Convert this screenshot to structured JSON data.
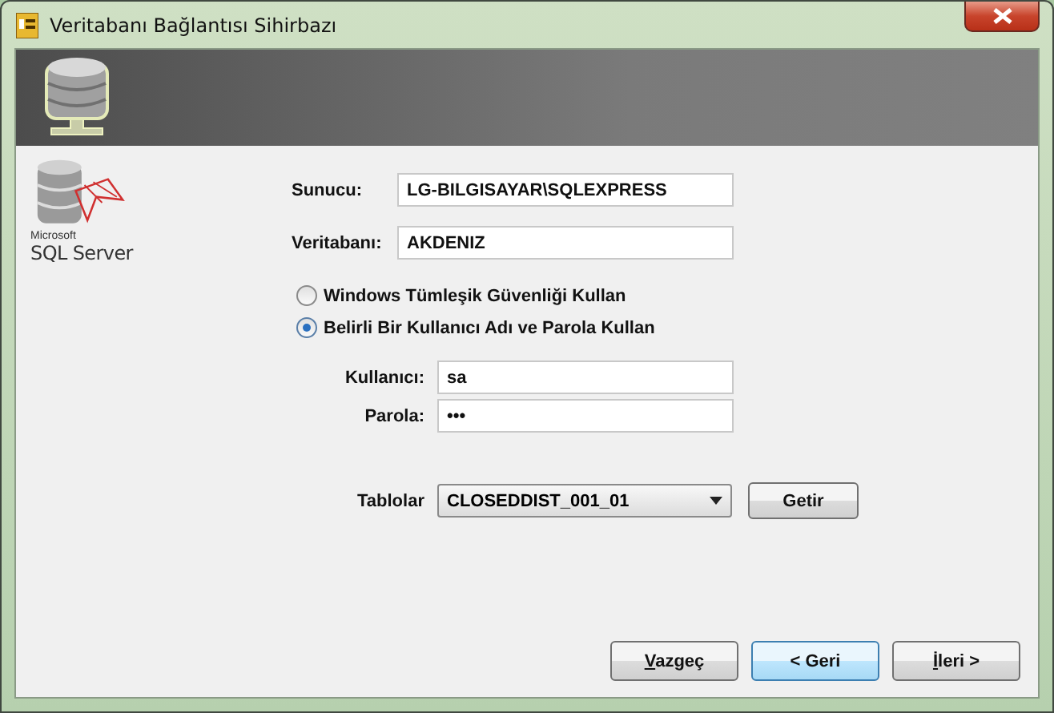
{
  "window": {
    "title": "Veritabanı Bağlantısı Sihirbazı"
  },
  "logo": {
    "vendor": "Microsoft",
    "product": "SQL Server"
  },
  "server": {
    "label": "Sunucu:",
    "value": "LG-BILGISAYAR\\SQLEXPRESS"
  },
  "database": {
    "label": "Veritabanı:",
    "value": "AKDENIZ"
  },
  "auth_options": [
    {
      "label": "Windows Tümleşik Güvenliği Kullan",
      "selected": false
    },
    {
      "label": "Belirli Bir Kullanıcı Adı ve Parola Kullan",
      "selected": true
    }
  ],
  "username": {
    "label": "Kullanıcı:",
    "value": "sa"
  },
  "password": {
    "label": "Parola:",
    "value": "•••"
  },
  "tables": {
    "label": "Tablolar",
    "value": "CLOSEDDIST_001_01",
    "button": "Getir"
  },
  "buttons": [
    {
      "mnemonic": "V",
      "rest": "azgeç",
      "default": false
    },
    {
      "rest": "< Geri",
      "default": true
    },
    {
      "mnemonic": "İ",
      "rest": "leri >",
      "default": false
    }
  ]
}
